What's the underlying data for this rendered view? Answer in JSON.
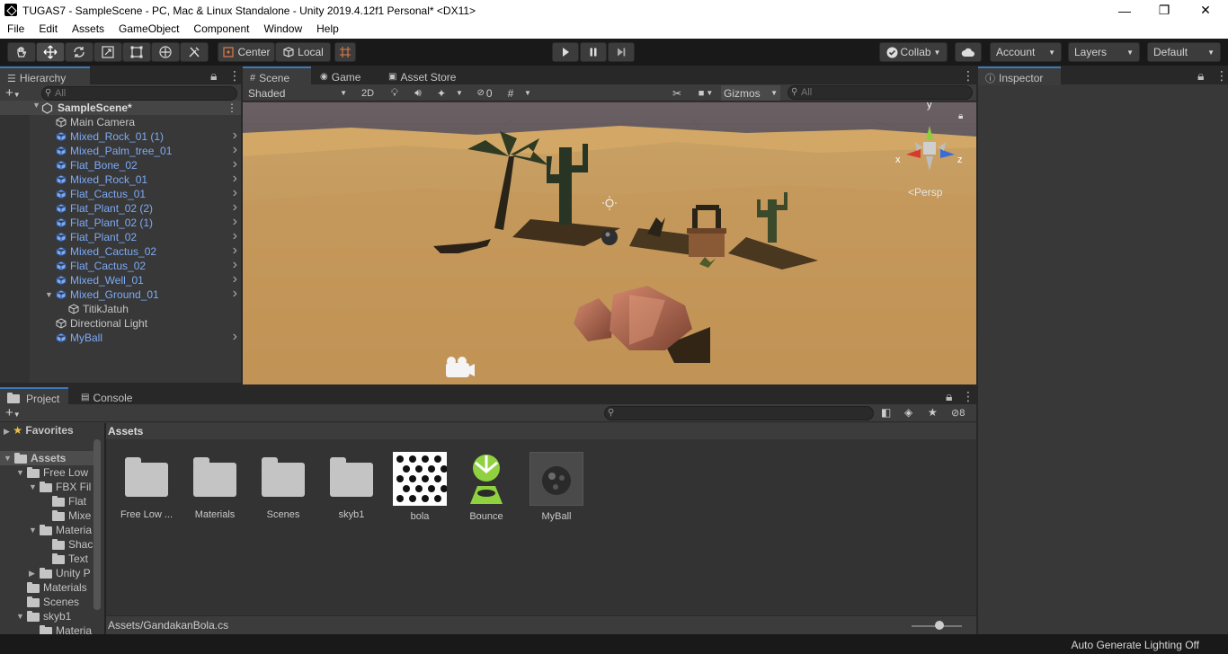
{
  "window": {
    "title": "TUGAS7 - SampleScene - PC, Mac & Linux Standalone - Unity 2019.4.12f1 Personal* <DX11>",
    "minimize": "—",
    "maximize": "❐",
    "close": "✕"
  },
  "menu": [
    "File",
    "Edit",
    "Assets",
    "GameObject",
    "Component",
    "Window",
    "Help"
  ],
  "toolbar": {
    "pivot_label": "Center",
    "space_label": "Local",
    "collab_label": "Collab",
    "account_label": "Account",
    "layers_label": "Layers",
    "layout_label": "Default"
  },
  "hierarchy": {
    "tab_label": "Hierarchy",
    "search_placeholder": "All",
    "scene_name": "SampleScene*",
    "items": [
      {
        "label": "Main Camera",
        "prefab": false,
        "indent": 1,
        "children": false
      },
      {
        "label": "Mixed_Rock_01 (1)",
        "prefab": true,
        "indent": 1,
        "children": true
      },
      {
        "label": "Mixed_Palm_tree_01",
        "prefab": true,
        "indent": 1,
        "children": true
      },
      {
        "label": "Flat_Bone_02",
        "prefab": true,
        "indent": 1,
        "children": true
      },
      {
        "label": "Mixed_Rock_01",
        "prefab": true,
        "indent": 1,
        "children": true
      },
      {
        "label": "Flat_Cactus_01",
        "prefab": true,
        "indent": 1,
        "children": true
      },
      {
        "label": "Flat_Plant_02 (2)",
        "prefab": true,
        "indent": 1,
        "children": true
      },
      {
        "label": "Flat_Plant_02 (1)",
        "prefab": true,
        "indent": 1,
        "children": true
      },
      {
        "label": "Flat_Plant_02",
        "prefab": true,
        "indent": 1,
        "children": true
      },
      {
        "label": "Mixed_Cactus_02",
        "prefab": true,
        "indent": 1,
        "children": true
      },
      {
        "label": "Flat_Cactus_02",
        "prefab": true,
        "indent": 1,
        "children": true
      },
      {
        "label": "Mixed_Well_01",
        "prefab": true,
        "indent": 1,
        "children": true
      },
      {
        "label": "Mixed_Ground_01",
        "prefab": true,
        "indent": 1,
        "children": true,
        "expanded": true
      },
      {
        "label": "TitikJatuh",
        "prefab": false,
        "indent": 2,
        "children": false
      },
      {
        "label": "Directional Light",
        "prefab": false,
        "indent": 1,
        "children": false
      },
      {
        "label": "MyBall",
        "prefab": true,
        "indent": 1,
        "children": true
      }
    ]
  },
  "scene": {
    "tabs": [
      "Scene",
      "Game",
      "Asset Store"
    ],
    "shading_mode": "Shaded",
    "mode_2d": "2D",
    "hidden_count": "0",
    "gizmos_label": "Gizmos",
    "search_placeholder": "All",
    "persp_label": "Persp",
    "axis_labels": {
      "y": "y",
      "x": "x",
      "z": "z"
    }
  },
  "inspector": {
    "tab_label": "Inspector"
  },
  "project": {
    "tabs": [
      "Project",
      "Console"
    ],
    "favorites_label": "Favorites",
    "breadcrumb": "Assets",
    "hidden_packages": "8",
    "tree": [
      {
        "label": "Assets",
        "indent": 0,
        "bold": true,
        "expanded": true
      },
      {
        "label": "Free Low",
        "indent": 1,
        "expanded": true
      },
      {
        "label": "FBX Fil",
        "indent": 2,
        "expanded": true
      },
      {
        "label": "Flat",
        "indent": 3
      },
      {
        "label": "Mixe",
        "indent": 3
      },
      {
        "label": "Materia",
        "indent": 2,
        "expanded": true
      },
      {
        "label": "Shac",
        "indent": 3
      },
      {
        "label": "Text",
        "indent": 3
      },
      {
        "label": "Unity P",
        "indent": 2,
        "collapsed": true
      },
      {
        "label": "Materials",
        "indent": 1
      },
      {
        "label": "Scenes",
        "indent": 1
      },
      {
        "label": "skyb1",
        "indent": 1,
        "expanded": true
      },
      {
        "label": "Materia",
        "indent": 2
      }
    ],
    "assets": [
      {
        "label": "Free Low ...",
        "kind": "folder"
      },
      {
        "label": "Materials",
        "kind": "folder"
      },
      {
        "label": "Scenes",
        "kind": "folder"
      },
      {
        "label": "skyb1",
        "kind": "folder"
      },
      {
        "label": "bola",
        "kind": "texture"
      },
      {
        "label": "Bounce",
        "kind": "physic-material"
      },
      {
        "label": "MyBall",
        "kind": "prefab"
      }
    ],
    "footer_path": "Assets/GandakanBola.cs"
  },
  "status": {
    "lighting": "Auto Generate Lighting Off"
  },
  "colors": {
    "accent": "#3a79bb",
    "prefab_text": "#7caaf5",
    "bounce_green": "#8fd13f"
  }
}
